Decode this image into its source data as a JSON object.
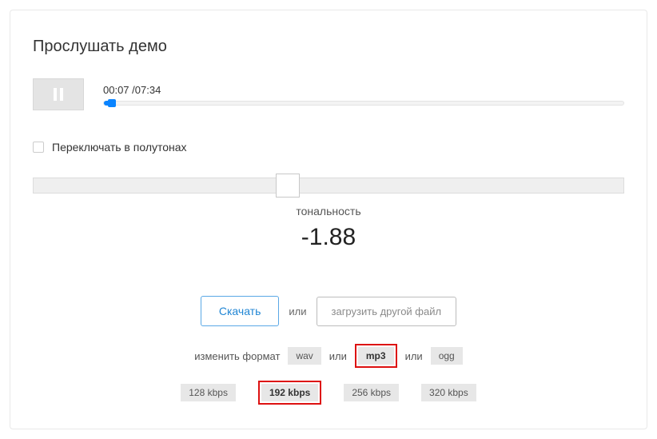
{
  "title": "Прослушать демо",
  "player": {
    "current": "00:07",
    "sep": " /",
    "total": "07:34",
    "progress_percent": 1.5
  },
  "semitone": {
    "checkbox_label": "Переключать в полутонах",
    "checked": false
  },
  "tone": {
    "label": "тональность",
    "value": "-1.88",
    "slider_percent": 41
  },
  "actions": {
    "download": "Скачать",
    "or": "или",
    "upload_other": "загрузить другой файл"
  },
  "format": {
    "change_label": "изменить формат",
    "wav": "wav",
    "or1": "или",
    "mp3": "mp3",
    "or2": "или",
    "ogg": "ogg",
    "selected": "mp3"
  },
  "bitrate": {
    "b128": "128 kbps",
    "b192": "192 kbps",
    "b256": "256 kbps",
    "b320": "320 kbps",
    "selected": "192 kbps"
  }
}
